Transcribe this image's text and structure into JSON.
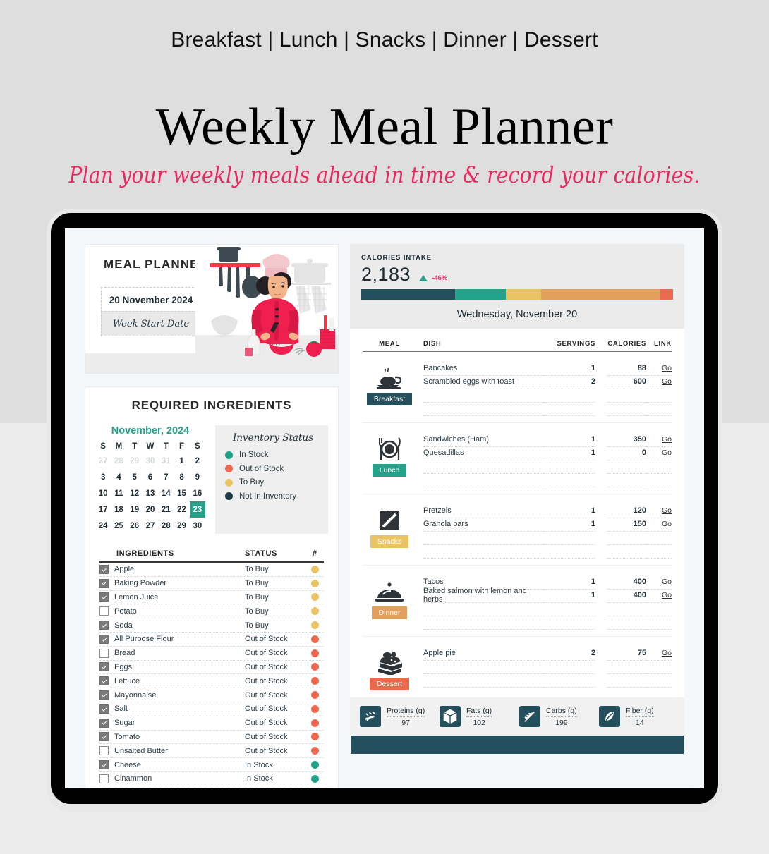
{
  "header": {
    "kicker": "Breakfast | Lunch | Snacks | Dinner | Dessert",
    "title": "Weekly Meal Planner",
    "subtitle": "Plan your weekly meals ahead in time & record your calories.",
    "accent_pink": "#ef2560"
  },
  "planner": {
    "title": "MEAL PLANNER",
    "date_value": "20 November 2024",
    "date_caption": "Week Start Date"
  },
  "ingredients_panel": {
    "title": "REQUIRED INGREDIENTS",
    "calendar": {
      "month_label": "November, 2024",
      "weekdays": [
        "S",
        "M",
        "T",
        "W",
        "T",
        "F",
        "S"
      ],
      "weeks": [
        [
          {
            "d": "27",
            "mute": true
          },
          {
            "d": "28",
            "mute": true
          },
          {
            "d": "29",
            "mute": true
          },
          {
            "d": "30",
            "mute": true
          },
          {
            "d": "31",
            "mute": true
          },
          {
            "d": "1"
          },
          {
            "d": "2"
          }
        ],
        [
          {
            "d": "3"
          },
          {
            "d": "4"
          },
          {
            "d": "5"
          },
          {
            "d": "6"
          },
          {
            "d": "7"
          },
          {
            "d": "8"
          },
          {
            "d": "9"
          }
        ],
        [
          {
            "d": "10"
          },
          {
            "d": "11"
          },
          {
            "d": "12"
          },
          {
            "d": "13"
          },
          {
            "d": "14"
          },
          {
            "d": "15"
          },
          {
            "d": "16"
          }
        ],
        [
          {
            "d": "17"
          },
          {
            "d": "18"
          },
          {
            "d": "19"
          },
          {
            "d": "20"
          },
          {
            "d": "21"
          },
          {
            "d": "22"
          },
          {
            "d": "23",
            "selected": true
          }
        ],
        [
          {
            "d": "24"
          },
          {
            "d": "25"
          },
          {
            "d": "26"
          },
          {
            "d": "27"
          },
          {
            "d": "28"
          },
          {
            "d": "29"
          },
          {
            "d": "30"
          }
        ]
      ],
      "month_color": "#27a38b",
      "selected_bg": "#2aa08b"
    },
    "inventory": {
      "title": "Inventory Status",
      "legend": [
        {
          "label": "In Stock",
          "color": "#1ea387"
        },
        {
          "label": "Out of Stock",
          "color": "#f0674e"
        },
        {
          "label": "To Buy",
          "color": "#eac462"
        },
        {
          "label": "Not In Inventory",
          "color": "#1d3a46"
        }
      ]
    },
    "table": {
      "headers": {
        "ingredients": "INGREDIENTS",
        "status": "STATUS",
        "hash": "#"
      },
      "rows": [
        {
          "checked": true,
          "name": "Apple",
          "status": "To Buy",
          "color": "#eac462"
        },
        {
          "checked": true,
          "name": "Baking Powder",
          "status": "To Buy",
          "color": "#eac462"
        },
        {
          "checked": true,
          "name": "Lemon Juice",
          "status": "To Buy",
          "color": "#eac462"
        },
        {
          "checked": false,
          "name": "Potato",
          "status": "To Buy",
          "color": "#eac462"
        },
        {
          "checked": true,
          "name": "Soda",
          "status": "To Buy",
          "color": "#eac462"
        },
        {
          "checked": true,
          "name": "All Purpose Flour",
          "status": "Out of Stock",
          "color": "#f0674e"
        },
        {
          "checked": false,
          "name": "Bread",
          "status": "Out of Stock",
          "color": "#f0674e"
        },
        {
          "checked": true,
          "name": "Eggs",
          "status": "Out of Stock",
          "color": "#f0674e"
        },
        {
          "checked": true,
          "name": "Lettuce",
          "status": "Out of Stock",
          "color": "#f0674e"
        },
        {
          "checked": true,
          "name": "Mayonnaise",
          "status": "Out of Stock",
          "color": "#f0674e"
        },
        {
          "checked": true,
          "name": "Salt",
          "status": "Out of Stock",
          "color": "#f0674e"
        },
        {
          "checked": true,
          "name": "Sugar",
          "status": "Out of Stock",
          "color": "#f0674e"
        },
        {
          "checked": true,
          "name": "Tomato",
          "status": "Out of Stock",
          "color": "#f0674e"
        },
        {
          "checked": false,
          "name": "Unsalted Butter",
          "status": "Out of Stock",
          "color": "#f0674e"
        },
        {
          "checked": true,
          "name": "Cheese",
          "status": "In Stock",
          "color": "#1ea387"
        },
        {
          "checked": false,
          "name": "Cinammon",
          "status": "In Stock",
          "color": "#1ea387"
        }
      ]
    }
  },
  "calories": {
    "kicker": "CALORIES INTAKE",
    "value": "2,183",
    "delta": "-46%",
    "delta_direction": "up",
    "delta_color": "#ef2560",
    "arrow_color": "#2aa08b",
    "day_label": "Wednesday, November 20",
    "bar_segments": [
      {
        "color": "#24505e",
        "pct": 30.0
      },
      {
        "color": "#24a38b",
        "pct": 16.3
      },
      {
        "color": "#eac462",
        "pct": 11.3
      },
      {
        "color": "#e3a05c",
        "pct": 38.3
      },
      {
        "color": "#eb6a4d",
        "pct": 4.1
      }
    ]
  },
  "meal_table": {
    "headers": {
      "meal": "MEAL",
      "dish": "DISH",
      "servings": "SERVINGS",
      "calories": "CALORIES",
      "link": "LINK"
    },
    "link_label": "Go",
    "blocks": [
      {
        "meal": "Breakfast",
        "badge_color": "#24505e",
        "icon": "coffee-cup-icon",
        "rows": [
          {
            "dish": "Pancakes",
            "servings": "1",
            "calories": "88",
            "link": "Go"
          },
          {
            "dish": "Scrambled eggs with toast",
            "servings": "2",
            "calories": "600",
            "link": "Go"
          },
          {
            "dish": "",
            "servings": "",
            "calories": "",
            "link": ""
          },
          {
            "dish": "",
            "servings": "",
            "calories": "",
            "link": ""
          }
        ]
      },
      {
        "meal": "Lunch",
        "badge_color": "#24a38b",
        "icon": "plate-cutlery-icon",
        "rows": [
          {
            "dish": "Sandwiches (Ham)",
            "servings": "1",
            "calories": "350",
            "link": "Go"
          },
          {
            "dish": "Quesadillas",
            "servings": "1",
            "calories": "0",
            "link": "Go"
          },
          {
            "dish": "",
            "servings": "",
            "calories": "",
            "link": ""
          },
          {
            "dish": "",
            "servings": "",
            "calories": "",
            "link": ""
          }
        ]
      },
      {
        "meal": "Snacks",
        "badge_color": "#eac462",
        "icon": "snack-bag-icon",
        "rows": [
          {
            "dish": "Pretzels",
            "servings": "1",
            "calories": "120",
            "link": "Go"
          },
          {
            "dish": "Granola bars",
            "servings": "1",
            "calories": "150",
            "link": "Go"
          },
          {
            "dish": "",
            "servings": "",
            "calories": "",
            "link": ""
          },
          {
            "dish": "",
            "servings": "",
            "calories": "",
            "link": ""
          }
        ]
      },
      {
        "meal": "Dinner",
        "badge_color": "#e3a05c",
        "icon": "cloche-icon",
        "rows": [
          {
            "dish": "Tacos",
            "servings": "1",
            "calories": "400",
            "link": "Go"
          },
          {
            "dish": "Baked salmon with lemon and herbs",
            "servings": "1",
            "calories": "400",
            "link": "Go"
          },
          {
            "dish": "",
            "servings": "",
            "calories": "",
            "link": ""
          },
          {
            "dish": "",
            "servings": "",
            "calories": "",
            "link": ""
          }
        ]
      },
      {
        "meal": "Dessert",
        "badge_color": "#eb6a4d",
        "icon": "cake-slice-icon",
        "rows": [
          {
            "dish": "Apple pie",
            "servings": "2",
            "calories": "75",
            "link": "Go"
          },
          {
            "dish": "",
            "servings": "",
            "calories": "",
            "link": ""
          },
          {
            "dish": "",
            "servings": "",
            "calories": "",
            "link": ""
          }
        ]
      }
    ]
  },
  "nutrition": [
    {
      "label": "Proteins (g)",
      "value": "97",
      "icon": "protein-icon"
    },
    {
      "label": "Fats (g)",
      "value": "102",
      "icon": "fat-cube-icon"
    },
    {
      "label": "Carbs (g)",
      "value": "199",
      "icon": "wheat-icon"
    },
    {
      "label": "Fiber (g)",
      "value": "14",
      "icon": "leaf-icon"
    }
  ]
}
